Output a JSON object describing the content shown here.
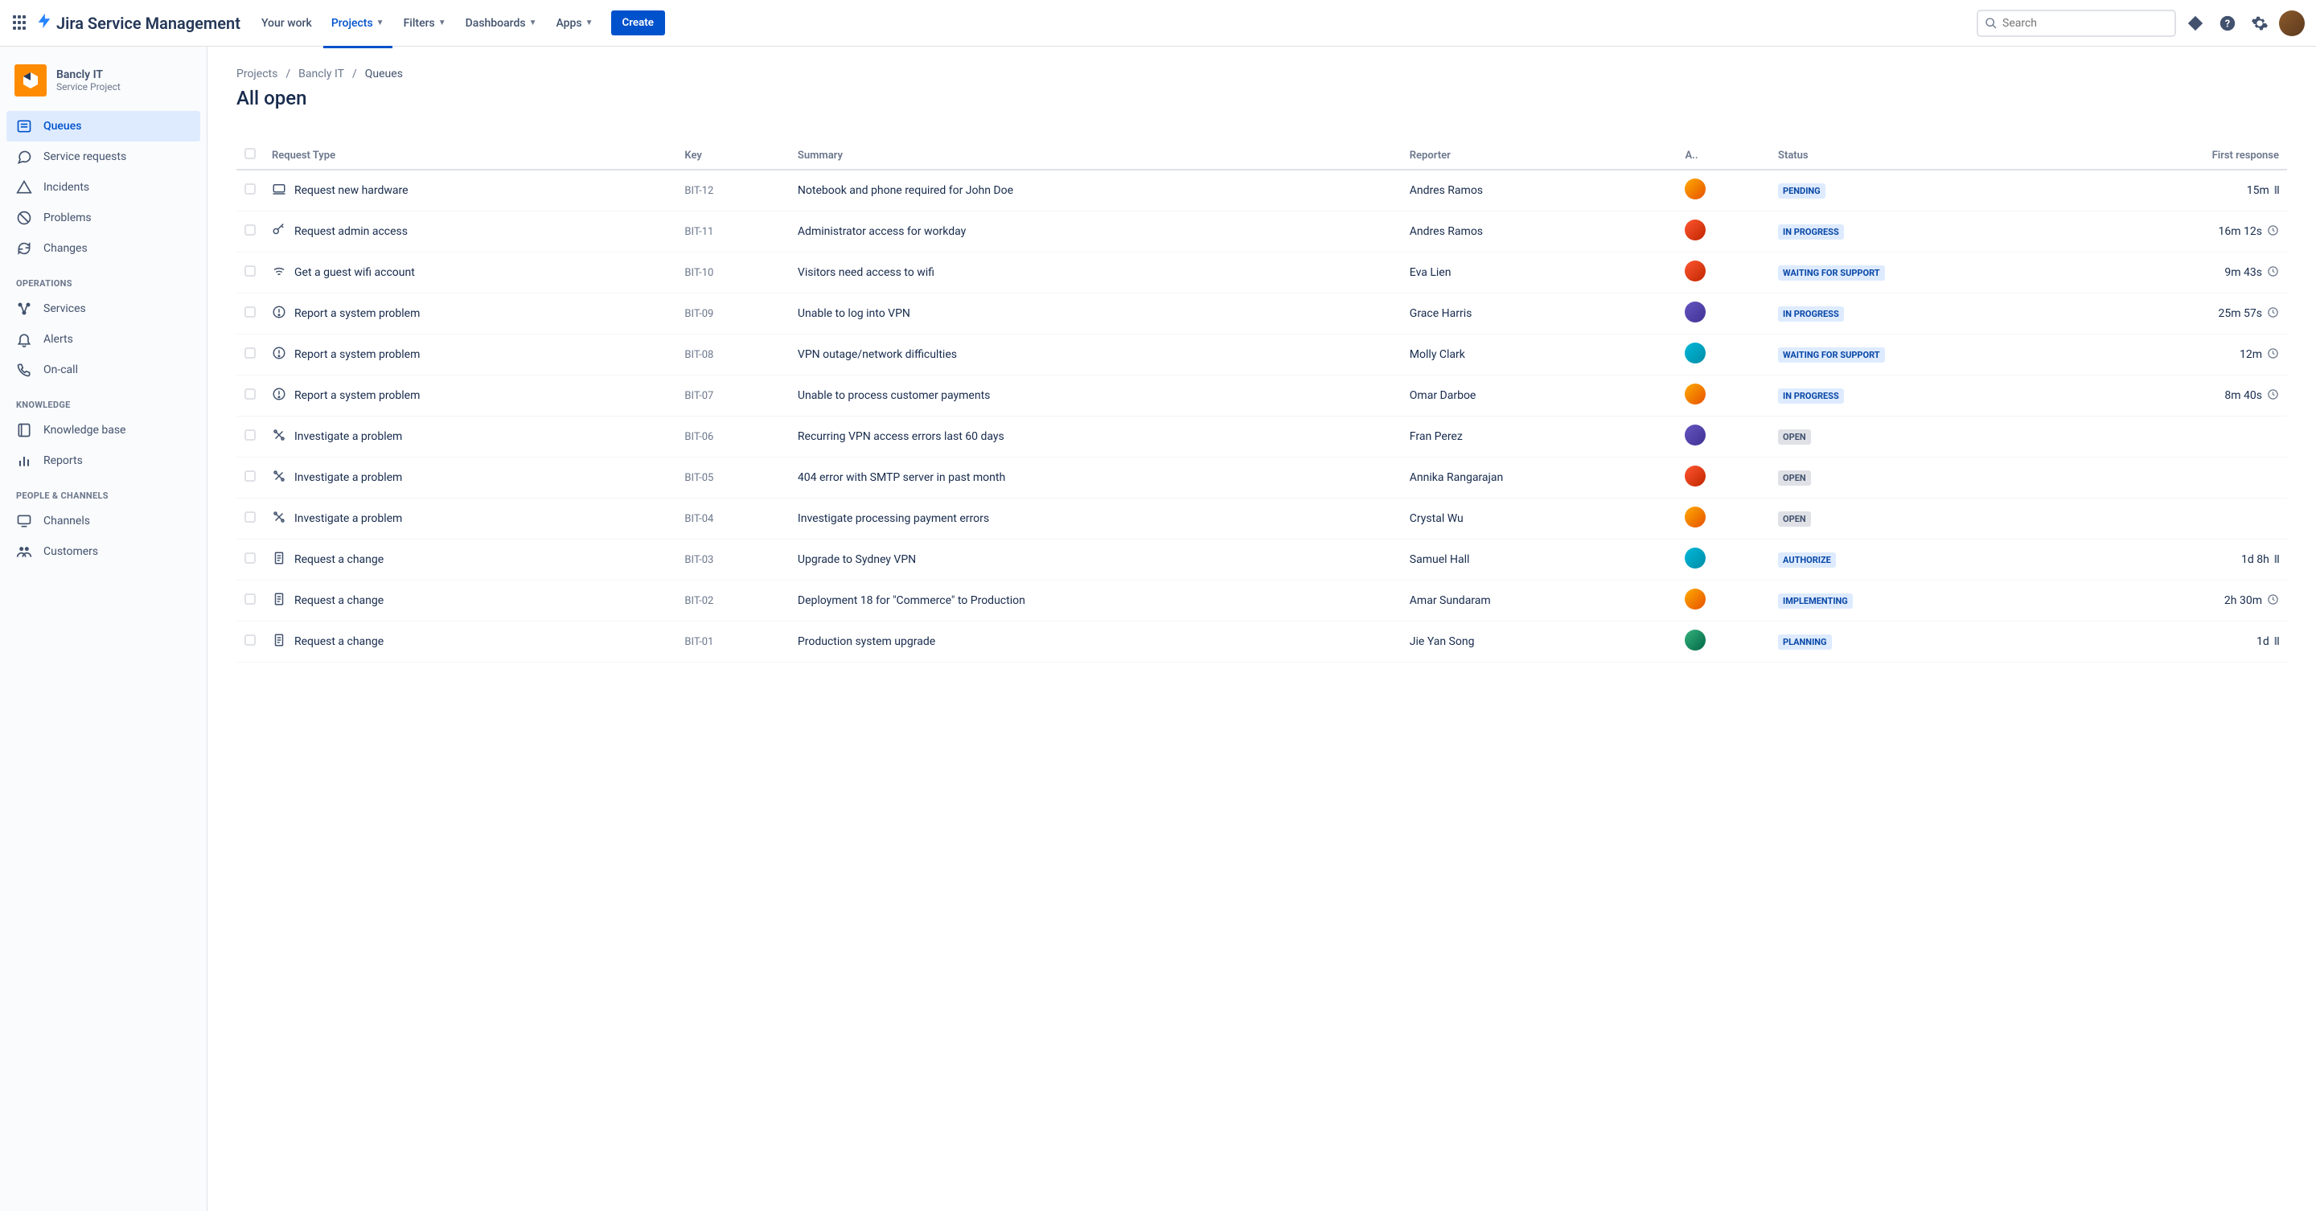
{
  "topbar": {
    "product": "Jira Service Management",
    "nav": [
      {
        "label": "Your work",
        "chev": false,
        "active": false
      },
      {
        "label": "Projects",
        "chev": true,
        "active": true
      },
      {
        "label": "Filters",
        "chev": true,
        "active": false
      },
      {
        "label": "Dashboards",
        "chev": true,
        "active": false
      },
      {
        "label": "Apps",
        "chev": true,
        "active": false
      }
    ],
    "create": "Create",
    "search_placeholder": "Search"
  },
  "sidebar": {
    "project": {
      "name": "Bancly IT",
      "sub": "Service Project"
    },
    "main_items": [
      {
        "icon": "queues",
        "label": "Queues",
        "active": true
      },
      {
        "icon": "chat",
        "label": "Service requests",
        "active": false
      },
      {
        "icon": "warn",
        "label": "Incidents",
        "active": false
      },
      {
        "icon": "block",
        "label": "Problems",
        "active": false
      },
      {
        "icon": "refresh",
        "label": "Changes",
        "active": false
      }
    ],
    "groups": [
      {
        "title": "OPERATIONS",
        "items": [
          {
            "icon": "services",
            "label": "Services"
          },
          {
            "icon": "bell",
            "label": "Alerts"
          },
          {
            "icon": "phone",
            "label": "On-call"
          }
        ]
      },
      {
        "title": "KNOWLEDGE",
        "items": [
          {
            "icon": "book",
            "label": "Knowledge base"
          },
          {
            "icon": "chart",
            "label": "Reports"
          }
        ]
      },
      {
        "title": "PEOPLE & CHANNELS",
        "items": [
          {
            "icon": "monitor",
            "label": "Channels"
          },
          {
            "icon": "people",
            "label": "Customers"
          }
        ]
      }
    ]
  },
  "breadcrumbs": {
    "a": "Projects",
    "b": "Bancly IT",
    "c": "Queues"
  },
  "page_title": "All open",
  "cols": {
    "rt": "Request Type",
    "key": "Key",
    "sum": "Summary",
    "rep": "Reporter",
    "asgn": "A..",
    "stat": "Status",
    "fr": "First response"
  },
  "rows": [
    {
      "rt_icon": "hw",
      "rt": "Request new hardware",
      "key": "BIT-12",
      "sum": "Notebook and phone required for John Doe",
      "rep": "Andres Ramos",
      "ac": "c1",
      "status": "PENDING",
      "sc": "s-blue",
      "fr": "15m",
      "ind": "pause"
    },
    {
      "rt_icon": "key",
      "rt": "Request admin access",
      "key": "BIT-11",
      "sum": "Administrator access for workday",
      "rep": "Andres Ramos",
      "ac": "c2",
      "status": "IN PROGRESS",
      "sc": "s-blue",
      "fr": "16m 12s",
      "ind": "clock"
    },
    {
      "rt_icon": "wifi",
      "rt": "Get a guest wifi account",
      "key": "BIT-10",
      "sum": "Visitors need access to wifi",
      "rep": "Eva Lien",
      "ac": "c2",
      "status": "WAITING FOR SUPPORT",
      "sc": "s-blue",
      "fr": "9m 43s",
      "ind": "clock"
    },
    {
      "rt_icon": "err",
      "rt": "Report a system problem",
      "key": "BIT-09",
      "sum": "Unable to log into VPN",
      "rep": "Grace Harris",
      "ac": "c3",
      "status": "IN PROGRESS",
      "sc": "s-blue",
      "fr": "25m 57s",
      "ind": "clock"
    },
    {
      "rt_icon": "err",
      "rt": "Report a system problem",
      "key": "BIT-08",
      "sum": "VPN outage/network difficulties",
      "rep": "Molly Clark",
      "ac": "c4",
      "status": "WAITING FOR SUPPORT",
      "sc": "s-blue",
      "fr": "12m",
      "ind": "clock"
    },
    {
      "rt_icon": "err",
      "rt": "Report a system problem",
      "key": "BIT-07",
      "sum": "Unable to process customer payments",
      "rep": "Omar Darboe",
      "ac": "c1",
      "status": "IN PROGRESS",
      "sc": "s-blue",
      "fr": "8m 40s",
      "ind": "clock"
    },
    {
      "rt_icon": "tools",
      "rt": "Investigate a problem",
      "key": "BIT-06",
      "sum": "Recurring VPN access errors last 60 days",
      "rep": "Fran Perez",
      "ac": "c3",
      "status": "OPEN",
      "sc": "s-grey",
      "fr": "",
      "ind": ""
    },
    {
      "rt_icon": "tools",
      "rt": "Investigate a problem",
      "key": "BIT-05",
      "sum": "404 error with SMTP server in past month",
      "rep": "Annika Rangarajan",
      "ac": "c2",
      "status": "OPEN",
      "sc": "s-grey",
      "fr": "",
      "ind": ""
    },
    {
      "rt_icon": "tools",
      "rt": "Investigate a problem",
      "key": "BIT-04",
      "sum": "Investigate processing payment errors",
      "rep": "Crystal Wu",
      "ac": "c1",
      "status": "OPEN",
      "sc": "s-grey",
      "fr": "",
      "ind": ""
    },
    {
      "rt_icon": "doc",
      "rt": "Request a change",
      "key": "BIT-03",
      "sum": "Upgrade to Sydney VPN",
      "rep": "Samuel Hall",
      "ac": "c4",
      "status": "AUTHORIZE",
      "sc": "s-blue",
      "fr": "1d 8h",
      "ind": "pause"
    },
    {
      "rt_icon": "doc",
      "rt": "Request a change",
      "key": "BIT-02",
      "sum": "Deployment 18 for \"Commerce\" to Production",
      "rep": "Amar Sundaram",
      "ac": "c1",
      "status": "IMPLEMENTING",
      "sc": "s-blue",
      "fr": "2h 30m",
      "ind": "clock"
    },
    {
      "rt_icon": "doc",
      "rt": "Request a change",
      "key": "BIT-01",
      "sum": "Production system upgrade",
      "rep": "Jie Yan Song",
      "ac": "c5",
      "status": "PLANNING",
      "sc": "s-blue",
      "fr": "1d",
      "ind": "pause"
    }
  ]
}
